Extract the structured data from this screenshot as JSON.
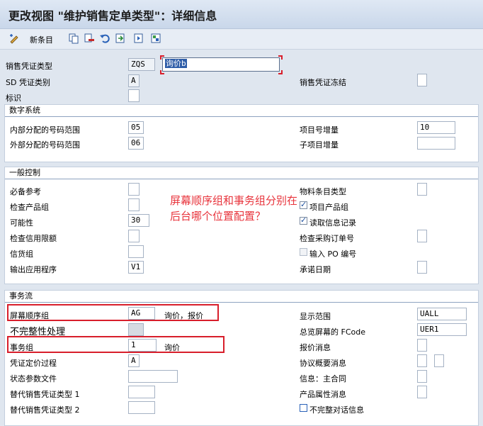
{
  "title": "更改视图 \"维护销售定单类型\"：详细信息",
  "toolbar": {
    "new_entries": "新条目"
  },
  "header": {
    "sales_doc_type_label": "销售凭证类型",
    "sales_doc_type_value": "ZQS",
    "sales_doc_type_desc": "询价b",
    "sd_category_label": "SD 凭证类别",
    "sd_category_value": "A",
    "sales_doc_block_label": "销售凭证冻结",
    "indicator_label": "标识"
  },
  "number_systems": {
    "title": "数字系统",
    "internal_range_label": "内部分配的号码范围",
    "internal_range_value": "05",
    "external_range_label": "外部分配的号码范围",
    "external_range_value": "06",
    "item_increment_label": "项目号增量",
    "item_increment_value": "10",
    "sub_item_increment_label": "子项目增量"
  },
  "general_control": {
    "title": "一般控制",
    "ref_mandatory_label": "必备参考",
    "check_division_label": "检查产品组",
    "probability_label": "可能性",
    "probability_value": "30",
    "check_credit_label": "检查信用限额",
    "credit_group_label": "信货组",
    "output_app_label": "输出应用程序",
    "output_app_value": "V1",
    "material_entry_type_label": "物料条目类型",
    "item_division_label": "项目产品组",
    "read_info_record_label": "读取信息记录",
    "check_po_number_label": "检查采购订单号",
    "enter_po_number_label": "输入 PO 编号",
    "commitment_date_label": "承诺日期"
  },
  "transaction_flow": {
    "title": "事务流",
    "screen_seq_group_label": "屏幕顺序组",
    "screen_seq_group_value": "AG",
    "screen_seq_group_desc": "询价，报价",
    "incompleteness_label": "不完整性处理",
    "transaction_group_label": "事务组",
    "transaction_group_value": "1",
    "transaction_group_desc": "询价",
    "doc_pricing_label": "凭证定价过程",
    "doc_pricing_value": "A",
    "status_profile_label": "状态参数文件",
    "alt_doc_type1_label": "替代销售凭证类型 1",
    "alt_doc_type2_label": "替代销售凭证类型 2",
    "display_range_label": "显示范围",
    "display_range_value": "UALL",
    "fcode_label": "总览屏幕的 FCode",
    "fcode_value": "UER1",
    "quotation_msg_label": "报价消息",
    "outline_agr_msg_label": "协议概要消息",
    "master_contract_label": "信息：主合同",
    "product_attr_msg_label": "产品属性消息",
    "incomplete_dialog_label": "不完整对话信息"
  },
  "annotation": "屏幕顺序组和事务组分别在后台哪个位置配置？"
}
